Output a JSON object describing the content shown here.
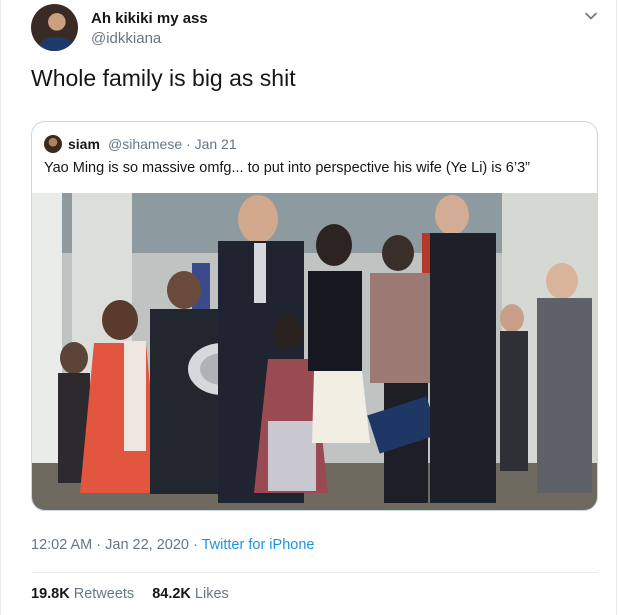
{
  "tweet": {
    "name": "Ah kikiki my ass",
    "handle": "@idkkiana",
    "text": "Whole family is big as shit",
    "timestamp": "12:02 AM · Jan 22, 2020 · ",
    "source": "Twitter for iPhone",
    "retweets_count": "19.8K",
    "retweets_label": "Retweets",
    "likes_count": "84.2K",
    "likes_label": "Likes",
    "menu_icon": "chevron-down-icon"
  },
  "quoted": {
    "name": "siam",
    "handle": "@sihamese · Jan 21",
    "text": "Yao Ming is so massive omfg... to put into perspective his wife (Ye Li) is 6’3”"
  },
  "colors": {
    "text": "#14171a",
    "muted": "#657786",
    "link": "#1b95e0",
    "border": "#ccd6dd"
  }
}
